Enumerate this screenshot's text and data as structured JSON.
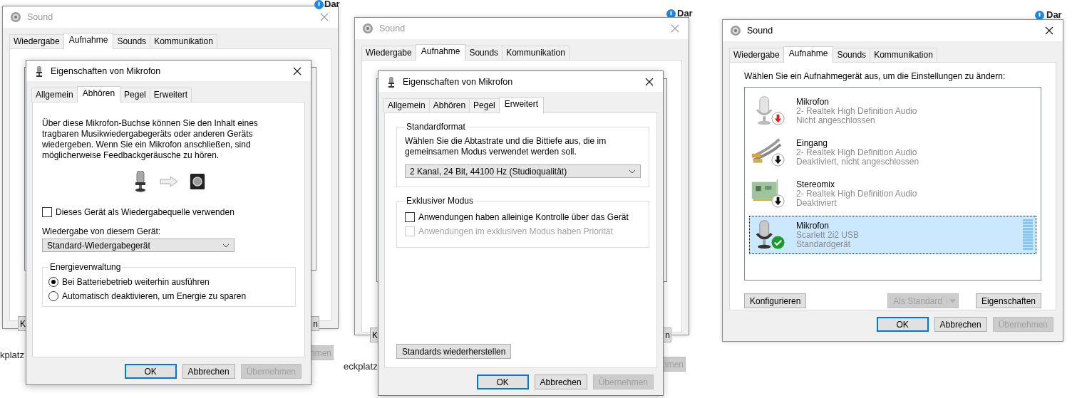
{
  "panels": [
    {
      "sound_window": {
        "title": "Sound",
        "active": false,
        "tabs": [
          {
            "label": "Wiedergabe",
            "selected": false
          },
          {
            "label": "Aufnahme",
            "selected": true
          },
          {
            "label": "Sounds",
            "selected": false
          },
          {
            "label": "Kommunikation",
            "selected": false
          }
        ],
        "button_fragments": [
          "K",
          "n",
          "nmen"
        ]
      },
      "dialog": {
        "title": "Eigenschaften von Mikrofon",
        "tabs": [
          {
            "label": "Allgemein",
            "selected": false
          },
          {
            "label": "Abhören",
            "selected": true
          },
          {
            "label": "Pegel",
            "selected": false
          },
          {
            "label": "Erweitert",
            "selected": false
          }
        ],
        "content": {
          "kind": "listen",
          "description": "Über diese Mikrofon-Buchse können Sie den Inhalt eines tragbaren Musikwiedergabegeräts oder anderen Geräts wiedergeben. Wenn Sie ein Mikrofon anschließen, sind möglicherweise Feedbackgeräusche zu hören.",
          "checkbox": {
            "label": "Dieses Gerät als Wiedergabequelle verwenden",
            "checked": false
          },
          "dropdown_label": "Wiedergabe von diesem Gerät:",
          "dropdown_value": "Standard-Wiedergabegerät",
          "group": {
            "title": "Energieverwaltung",
            "options": [
              {
                "label": "Bei Batteriebetrieb weiterhin ausführen",
                "selected": true
              },
              {
                "label": "Automatisch deaktivieren, um Energie zu sparen",
                "selected": false
              }
            ]
          }
        },
        "buttons": [
          {
            "label": "OK",
            "default": true,
            "disabled": false
          },
          {
            "label": "Abbrechen",
            "default": false,
            "disabled": false
          },
          {
            "label": "Übernehmen",
            "default": false,
            "disabled": true
          }
        ]
      },
      "background_texts": [
        "Dar",
        "kplatz"
      ]
    },
    {
      "sound_window": {
        "title": "Sound",
        "active": false,
        "tabs": [
          {
            "label": "Wiedergabe",
            "selected": false
          },
          {
            "label": "Aufnahme",
            "selected": true
          },
          {
            "label": "Sounds",
            "selected": false
          },
          {
            "label": "Kommunikation",
            "selected": false
          }
        ],
        "button_fragments": [
          "K",
          "n",
          "nmen"
        ]
      },
      "dialog": {
        "title": "Eigenschaften von Mikrofon",
        "tabs": [
          {
            "label": "Allgemein",
            "selected": false
          },
          {
            "label": "Abhören",
            "selected": false
          },
          {
            "label": "Pegel",
            "selected": false
          },
          {
            "label": "Erweitert",
            "selected": true
          }
        ],
        "content": {
          "kind": "advanced",
          "groups": [
            {
              "title": "Standardformat",
              "text": "Wählen Sie die Abtastrate und die Bittiefe aus, die im gemeinsamen Modus verwendet werden soll.",
              "dropdown_value": "2 Kanal, 24 Bit, 44100 Hz (Studioqualität)"
            },
            {
              "title": "Exklusiver Modus",
              "checkboxes": [
                {
                  "label": "Anwendungen haben alleinige Kontrolle über das Gerät",
                  "checked": false,
                  "disabled": false
                },
                {
                  "label": "Anwendungen im exklusiven Modus haben Priorität",
                  "checked": false,
                  "disabled": true
                }
              ]
            }
          ],
          "reset_button": "Standards wiederherstellen"
        },
        "buttons": [
          {
            "label": "OK",
            "default": true,
            "disabled": false
          },
          {
            "label": "Abbrechen",
            "default": false,
            "disabled": false
          },
          {
            "label": "Übernehmen",
            "default": false,
            "disabled": true
          }
        ]
      },
      "background_texts": [
        "Dar",
        "eckplatz"
      ]
    },
    {
      "sound_window": {
        "title": "Sound",
        "active": true,
        "tabs": [
          {
            "label": "Wiedergabe",
            "selected": false
          },
          {
            "label": "Aufnahme",
            "selected": true
          },
          {
            "label": "Sounds",
            "selected": false
          },
          {
            "label": "Kommunikation",
            "selected": false
          }
        ],
        "prompt": "Wählen Sie ein Aufnahmegerät aus, um die Einstellungen zu ändern:",
        "devices": [
          {
            "name": "Mikrofon",
            "driver": "2- Realtek High Definition Audio",
            "status": "Nicht angeschlossen",
            "kind": "microphone",
            "unplugged": true,
            "default": false,
            "selected": false
          },
          {
            "name": "Eingang",
            "driver": "2- Realtek High Definition Audio",
            "status": "Deaktiviert, nicht angeschlossen",
            "kind": "cable",
            "unplugged": false,
            "default": false,
            "selected": false
          },
          {
            "name": "Stereomix",
            "driver": "2- Realtek High Definition Audio",
            "status": "Deaktiviert",
            "kind": "card",
            "unplugged": false,
            "default": false,
            "selected": false
          },
          {
            "name": "Mikrofon",
            "driver": "Scarlett 2i2 USB",
            "status": "Standardgerät",
            "kind": "usb_microphone",
            "unplugged": false,
            "default": true,
            "selected": true
          }
        ],
        "actions": [
          {
            "label": "Konfigurieren",
            "kind": "plain",
            "disabled": false
          },
          {
            "label": "Als Standard",
            "kind": "split",
            "disabled": true
          },
          {
            "label": "Eigenschaften",
            "kind": "plain",
            "disabled": false
          }
        ],
        "buttons": [
          {
            "label": "OK",
            "default": true,
            "disabled": false
          },
          {
            "label": "Abbrechen",
            "default": false,
            "disabled": false
          },
          {
            "label": "Übernehmen",
            "default": false,
            "disabled": true
          }
        ]
      },
      "background_texts": [
        "Dar"
      ]
    }
  ]
}
